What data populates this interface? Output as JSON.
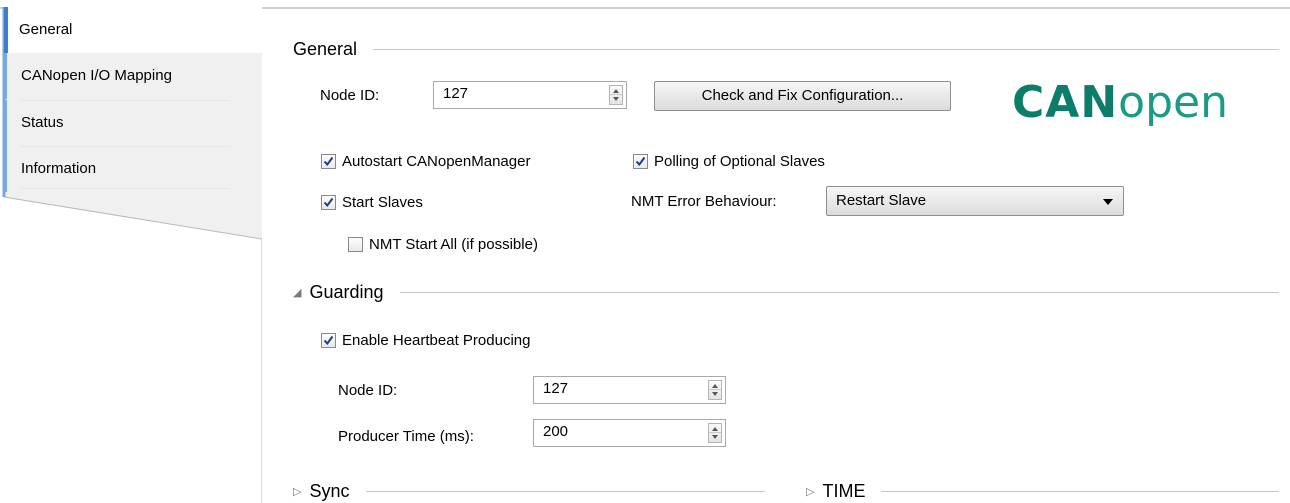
{
  "tabs": [
    {
      "label": "General"
    },
    {
      "label": "CANopen I/O Mapping"
    },
    {
      "label": "Status"
    },
    {
      "label": "Information"
    }
  ],
  "general": {
    "title": "General",
    "node_id_label": "Node ID:",
    "node_id_value": "127",
    "fix_button": "Check and Fix Configuration...",
    "logo_bold": "CAN",
    "logo_light": "open",
    "autostart_label": "Autostart CANopenManager",
    "autostart_checked": true,
    "polling_label": "Polling of Optional Slaves",
    "polling_checked": true,
    "start_slaves_label": "Start Slaves",
    "start_slaves_checked": true,
    "nmt_error_label": "NMT Error Behaviour:",
    "nmt_error_value": "Restart Slave",
    "nmt_start_all_label": "NMT Start All (if possible)",
    "nmt_start_all_checked": false
  },
  "guarding": {
    "title": "Guarding",
    "heartbeat_label": "Enable Heartbeat Producing",
    "heartbeat_checked": true,
    "node_id_label": "Node ID:",
    "node_id_value": "127",
    "producer_time_label": "Producer Time (ms):",
    "producer_time_value": "200"
  },
  "sync": {
    "title": "Sync"
  },
  "time": {
    "title": "TIME"
  },
  "colors": {
    "tab_accent": "#3c7fcf",
    "logo": "#0c7d6a"
  }
}
